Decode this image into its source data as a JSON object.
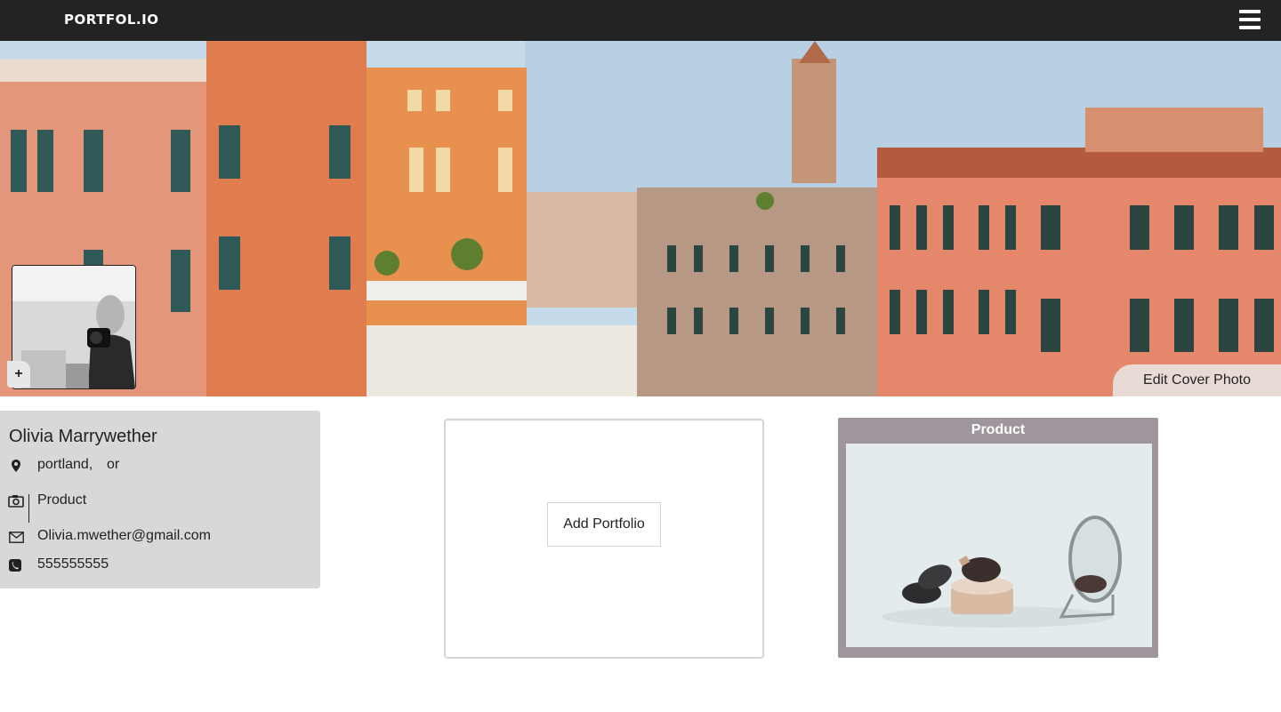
{
  "app": {
    "brand": "PORTFOL.IO",
    "menu_icon": "hamburger-menu-icon"
  },
  "cover": {
    "edit_label": "Edit Cover Photo",
    "avatar_add_label": "+"
  },
  "profile": {
    "name": "Olivia Marrywether",
    "city": "portland,",
    "state": "or",
    "category": "Product",
    "email": "Olivia.mwether@gmail.com",
    "phone": "555555555",
    "icons": [
      "map-marker-icon",
      "camera-icon",
      "envelope-icon",
      "phone-icon"
    ]
  },
  "portfolio": {
    "add_label": "Add Portfolio"
  },
  "products": [
    {
      "title": "Product"
    }
  ],
  "colors": {
    "topbar": "#232323",
    "profile_card": "#d8d8d8",
    "product_card": "#9e969c"
  }
}
